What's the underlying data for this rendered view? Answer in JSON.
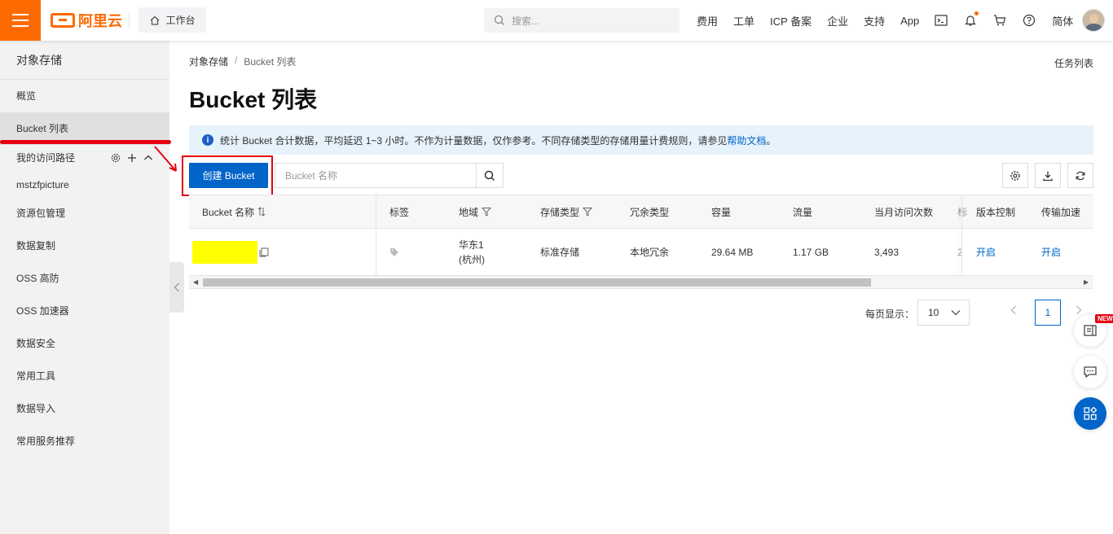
{
  "topbar": {
    "brand": "阿里云",
    "workbench": "工作台",
    "search_placeholder": "搜索...",
    "nav": [
      "费用",
      "工单",
      "ICP 备案",
      "企业",
      "支持",
      "App"
    ],
    "language": "简体",
    "icons": [
      "terminal-icon",
      "bell-icon",
      "cart-icon",
      "help-icon"
    ]
  },
  "sidebar": {
    "title": "对象存储",
    "items": [
      {
        "label": "概览"
      },
      {
        "label": "Bucket 列表"
      },
      {
        "label": "我的访问路径"
      },
      {
        "label": "mstzfpicture"
      },
      {
        "label": "资源包管理"
      },
      {
        "label": "数据复制"
      },
      {
        "label": "OSS 高防"
      },
      {
        "label": "OSS 加速器"
      },
      {
        "label": "数据安全"
      },
      {
        "label": "常用工具"
      },
      {
        "label": "数据导入"
      },
      {
        "label": "常用服务推荐"
      }
    ]
  },
  "breadcrumb": {
    "root": "对象存储",
    "sep": "/",
    "current": "Bucket 列表"
  },
  "task_list": "任务列表",
  "page_title": "Bucket 列表",
  "notice": {
    "text": "统计 Bucket 合计数据，平均延迟 1~3 小时。不作为计量数据，仅作参考。不同存储类型的存储用量计费规则，请参见",
    "link": "帮助文档",
    "end": "。"
  },
  "toolbar": {
    "create_label": "创建 Bucket",
    "search_placeholder": "Bucket 名称"
  },
  "table": {
    "headers": [
      "Bucket 名称",
      "标签",
      "地域",
      "存储类型",
      "冗余类型",
      "容量",
      "流量",
      "当月访问次数",
      "版本控制",
      "传输加速"
    ],
    "rows": [
      {
        "region_line1": "华东1",
        "region_line2": "(杭州)",
        "storage_type": "标准存储",
        "redundancy": "本地冗余",
        "capacity": "29.64 MB",
        "traffic": "1.17 GB",
        "visits": "3,493",
        "versioning": "开启",
        "acceleration": "开启"
      }
    ]
  },
  "pagination": {
    "per_page_label": "每页显示：",
    "per_page": "10",
    "current_page": "1"
  },
  "float": {
    "new_badge": "NEW"
  },
  "colors": {
    "brand": "#ff6a00",
    "primary": "#0064c8",
    "highlight": "#e60012"
  }
}
